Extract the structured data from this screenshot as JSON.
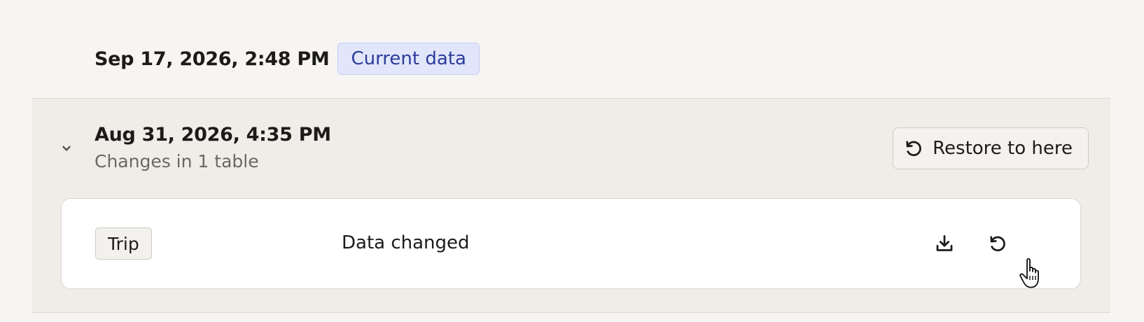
{
  "current": {
    "timestamp": "Sep 17, 2026, 2:48 PM",
    "badge": "Current data"
  },
  "snapshot": {
    "timestamp": "Aug 31, 2026, 4:35 PM",
    "summary": "Changes in 1 table",
    "expanded": true,
    "restore_label": "Restore to here",
    "changes": [
      {
        "table": "Trip",
        "status": "Data changed"
      }
    ]
  },
  "icons": {
    "expand": "chevron-down-icon",
    "restore": "restore-icon",
    "download": "download-icon",
    "pointer": "hand-pointer-icon"
  },
  "colors": {
    "badge_bg": "#e1e6fb",
    "badge_text": "#2d3c9a",
    "section_bg": "#f0ede8",
    "page_bg": "#f6f5f3"
  }
}
